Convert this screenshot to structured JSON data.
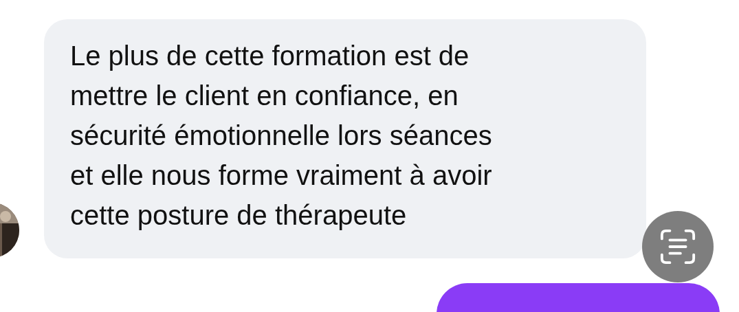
{
  "incoming_message": {
    "text": "Le plus de cette formation est de\nmettre le client en confiance, en\nsécurité émotionnelle lors séances\net elle nous forme vraiment à avoir\ncette posture de thérapeute"
  }
}
